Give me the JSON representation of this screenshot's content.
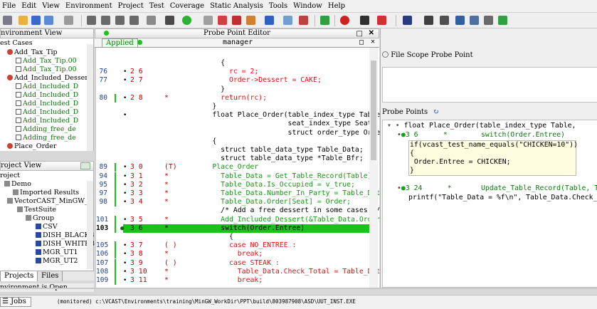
{
  "colors": {
    "accent_green": "#19c419",
    "probe_red": "#c00000",
    "line_number_blue": "#2040a0"
  },
  "menu": [
    "File",
    "Edit",
    "View",
    "Environment",
    "Project",
    "Test",
    "Coverage",
    "Static Analysis",
    "Tools",
    "Window",
    "Help"
  ],
  "env_view": {
    "title": "nvironment View",
    "root": "est Cases",
    "items": [
      {
        "label": "Add_Tax_Tip",
        "kind": "group"
      },
      {
        "label": "Add_Tax_Tip.00",
        "kind": "case"
      },
      {
        "label": "Add_Tax_Tip.00",
        "kind": "case"
      },
      {
        "label": "Add_Included_Desser",
        "kind": "group"
      },
      {
        "label": "Add_Included_D",
        "kind": "case"
      },
      {
        "label": "Add_Included_D",
        "kind": "case"
      },
      {
        "label": "Add_Included_D",
        "kind": "case"
      },
      {
        "label": "Add_Included_D",
        "kind": "case"
      },
      {
        "label": "Add_Included_D",
        "kind": "case"
      },
      {
        "label": "Adding_free_de",
        "kind": "case"
      },
      {
        "label": "Adding_free_de",
        "kind": "case"
      },
      {
        "label": "Place_Order",
        "kind": "group"
      }
    ]
  },
  "project_view": {
    "title": "roject View",
    "root": "roject",
    "items": [
      "Demo",
      "Imported Results",
      "VectorCAST_MinGW_C",
      "TestSuite",
      "Group",
      "CSV",
      "DISH_BLACKB",
      "DISH_WHITEB",
      "MGR_UT1",
      "MGR_UT2"
    ]
  },
  "left_tabs": {
    "projects": "Projects",
    "files": "Files"
  },
  "status_left": "nvironment is Open",
  "bottom": {
    "jobs": "Jobs",
    "status": "(monitored)  c:\\VCAST\\Environments\\training\\MinGW_WorkDir\\PPT\\build\\803987908\\ASD\\UUT_INST.EXE"
  },
  "editor": {
    "title": "Probe Point Editor",
    "applied": "Applied",
    "file": "manager",
    "lines": [
      {
        "ln": "",
        "pp": "",
        "probe": false,
        "text": "        {"
      },
      {
        "ln": "76",
        "pp": "2 6",
        "probe": false,
        "text": "          rc = 2;"
      },
      {
        "ln": "77",
        "pp": "2 7",
        "probe": false,
        "text": "          Order->Dessert = CAKE;"
      },
      {
        "ln": "",
        "pp": "",
        "probe": false,
        "text": "        }"
      },
      {
        "ln": "80",
        "pp": "2 8",
        "mark": "*",
        "probe": false,
        "text": "        return(rc);"
      },
      {
        "ln": "",
        "pp": "",
        "probe": false,
        "text": "      }"
      },
      {
        "ln": "",
        "pp": "",
        "probe": false,
        "text": "      float Place_Order(table_index_type Table,"
      },
      {
        "ln": "",
        "pp": "",
        "probe": false,
        "text": "                        seat_index_type Seat,"
      },
      {
        "ln": "",
        "pp": "",
        "probe": false,
        "text": "                        struct order_type Order)"
      },
      {
        "ln": "",
        "pp": "",
        "probe": false,
        "text": "      {"
      },
      {
        "ln": "",
        "pp": "",
        "probe": false,
        "text": "        struct table_data_type Table_Data;"
      },
      {
        "ln": "",
        "pp": "",
        "probe": false,
        "text": "        struct table_data_type *Table_Bfr;"
      },
      {
        "ln": "89",
        "pp": "3 0",
        "mark": "(T)",
        "probe": false,
        "text": "      Place_Order"
      },
      {
        "ln": "94",
        "pp": "3 1",
        "mark": "*",
        "probe": false,
        "text": "        Table_Data = Get_Table_Record(Table);"
      },
      {
        "ln": "95",
        "pp": "3 2",
        "mark": "*",
        "probe": false,
        "text": "        Table_Data.Is_Occupied = v_true;"
      },
      {
        "ln": "97",
        "pp": "3 3",
        "mark": "*",
        "probe": false,
        "text": "        Table_Data.Number_In_Party = Table_Data."
      },
      {
        "ln": "98",
        "pp": "3 4",
        "mark": "*",
        "probe": false,
        "text": "        Table_Data.Order[Seat] = Order;"
      },
      {
        "ln": "",
        "pp": "",
        "probe": false,
        "text": "        /* Add a free dessert in some cases */"
      },
      {
        "ln": "101",
        "pp": "3 5",
        "mark": "*",
        "probe": false,
        "text": "        Add_Included_Dessert(&Table_Data.Order[S"
      },
      {
        "ln": "103",
        "pp": "3 6",
        "mark": "*",
        "probe": true,
        "text": "        switch(Order.Entree)"
      },
      {
        "ln": "",
        "pp": "",
        "probe": false,
        "text": "          {"
      },
      {
        "ln": "105",
        "pp": "3 7",
        "mark": "( )",
        "probe": false,
        "text": "          case NO_ENTREE :"
      },
      {
        "ln": "106",
        "pp": "3 8",
        "mark": "*",
        "probe": false,
        "text": "            break;"
      },
      {
        "ln": "107",
        "pp": "3 9",
        "mark": "( )",
        "probe": false,
        "text": "          case STEAK :"
      },
      {
        "ln": "108",
        "pp": "3 10",
        "mark": "*",
        "probe": false,
        "text": "            Table_Data.Check_Total = Table_Data."
      },
      {
        "ln": "109",
        "pp": "3 11",
        "mark": "*",
        "probe": false,
        "text": "            break;"
      }
    ]
  },
  "right": {
    "file_scope_label": "File Scope Probe Point",
    "probe_points_label": "Probe Points",
    "tree_header": "float Place_Order(table_index_type Table,",
    "pp1_head": "3 6      *        switch(Order.Entree)",
    "pp1_code": [
      "if(vcast_test_name_equals(\"CHICKEN=10\"))",
      "{",
      " Order.Entree = CHICKEN;",
      "}"
    ],
    "pp2_head": "3 24      *       Update_Table_Record(Table, T",
    "pp2_code": "printf(\"Table_Data = %f\\n\", Table_Data.Check_"
  }
}
